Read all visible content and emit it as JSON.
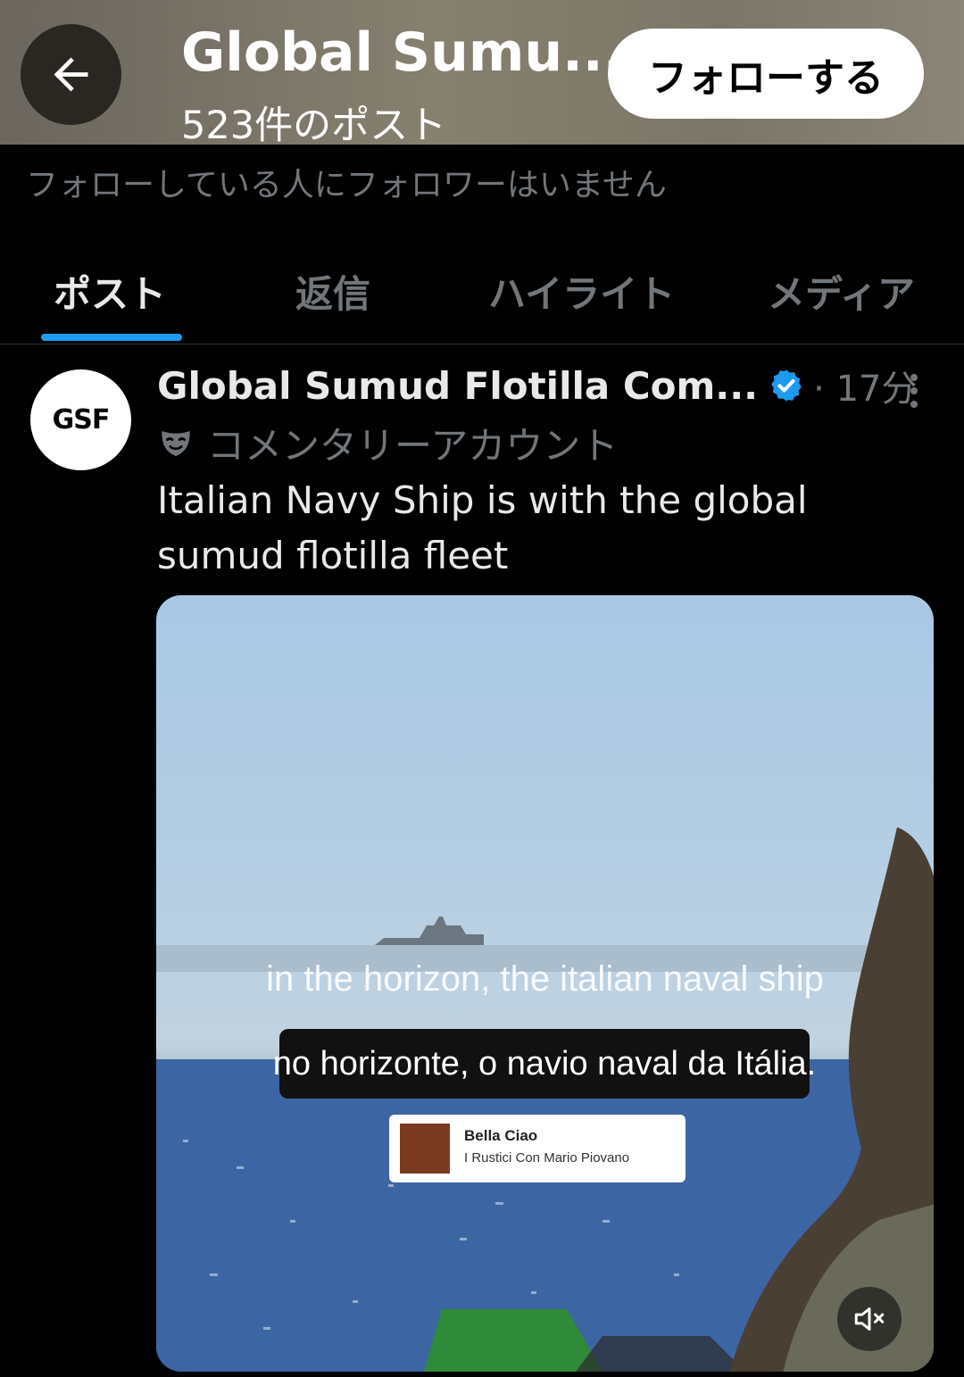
{
  "header": {
    "profile_name": "Global Sumu...",
    "post_count": "523件のポスト",
    "follow_label": "フォローする"
  },
  "profile": {
    "followers_note": "フォローしている人にフォロワーはいません"
  },
  "tabs": [
    {
      "label": "ポスト",
      "active": true
    },
    {
      "label": "返信",
      "active": false
    },
    {
      "label": "ハイライト",
      "active": false
    },
    {
      "label": "メディア",
      "active": false
    }
  ],
  "post": {
    "avatar_text": "GSF",
    "author_name": "Global Sumud Flotilla Com...",
    "time": "· 17分",
    "account_label": "コメンタリーアカウント",
    "text": "Italian Navy Ship is with the global sumud flotilla fleet",
    "media": {
      "caption_en": "in the horizon, the italian naval ship",
      "caption_pt": "no horizonte, o navio naval da Itália.",
      "music_title": "Bella Ciao",
      "music_artist": "I Rustici Con Mario Piovano"
    }
  },
  "colors": {
    "accent": "#1d9bf0",
    "background": "#000000",
    "muted_text": "#71767b"
  },
  "icons": [
    "back-arrow-icon",
    "verified-badge-icon",
    "more-icon",
    "mask-icon",
    "mute-icon"
  ]
}
